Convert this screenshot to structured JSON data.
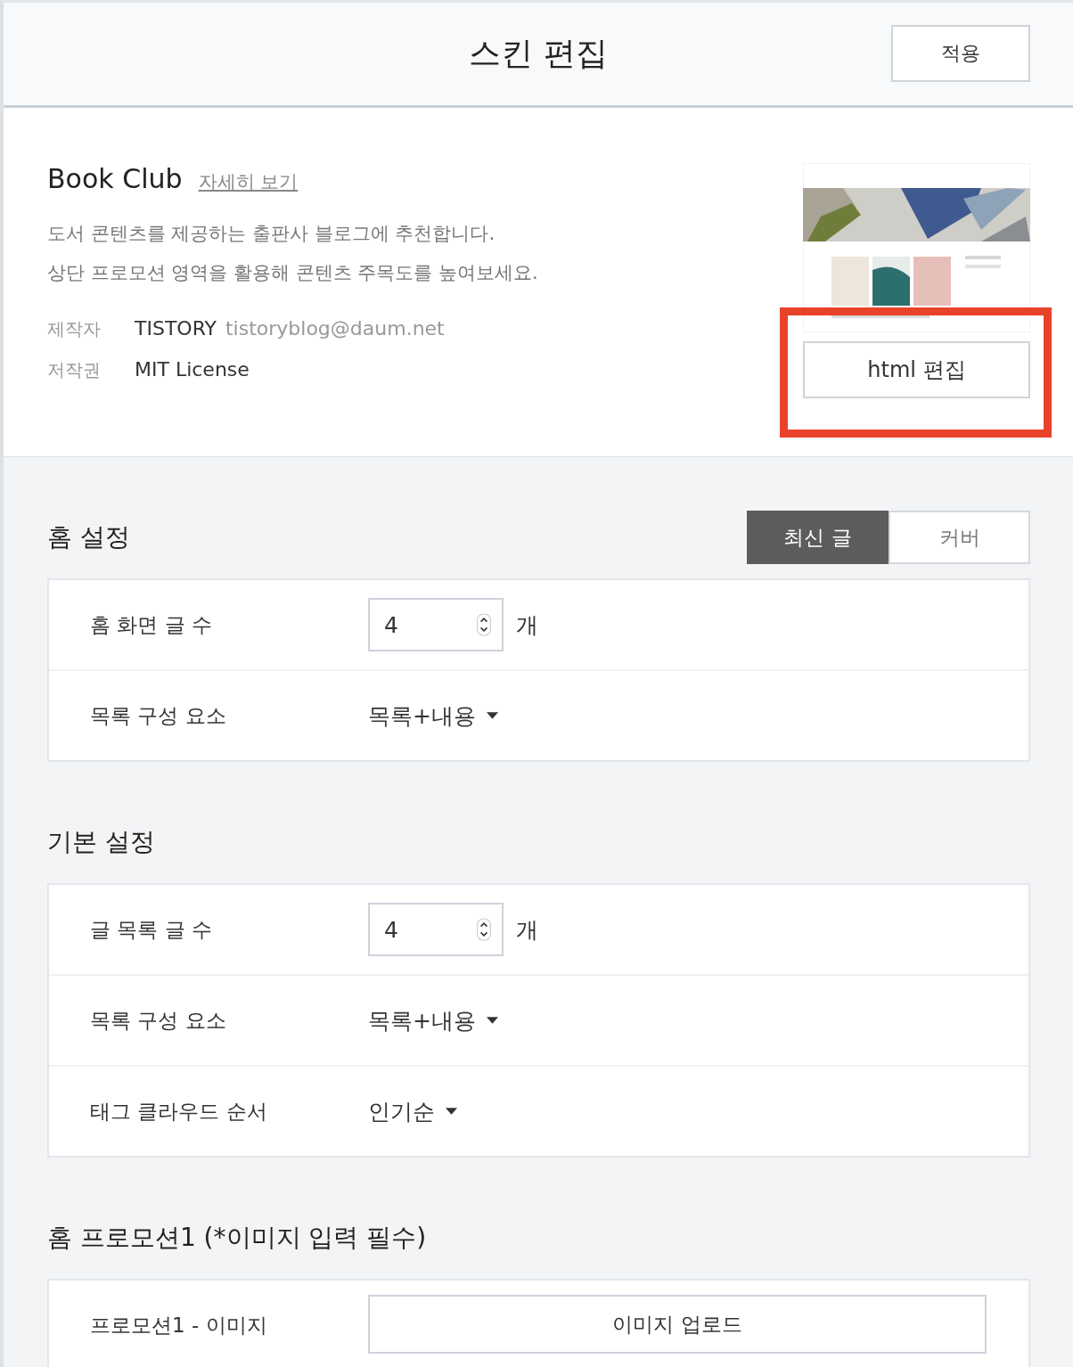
{
  "header": {
    "title": "스킨 편집",
    "apply_button": "적용"
  },
  "skin": {
    "name": "Book Club",
    "details_link": "자세히 보기",
    "description": [
      "도서 콘텐츠를 제공하는 출판사 블로그에 추천합니다.",
      "상단 프로모션 영역을 활용해 콘텐츠 주목도를 높여보세요."
    ],
    "meta": [
      {
        "label": "제작자",
        "value": "TISTORY",
        "extra": "tistoryblog@daum.net"
      },
      {
        "label": "저작권",
        "value": "MIT License"
      }
    ],
    "preview": {
      "kind": "picture"
    },
    "html_button": "html 편집",
    "highlighted": true
  },
  "sections": [
    {
      "title": "홈 설정",
      "tabs": [
        {
          "label": "최신 글",
          "selected": true
        },
        {
          "label": "커버",
          "selected": false
        }
      ],
      "rows": [
        {
          "kind": "number",
          "label": "홈 화면 글 수",
          "value": "4",
          "unit": "개"
        },
        {
          "kind": "select",
          "label": "목록 구성 요소",
          "value": "목록+내용"
        }
      ]
    },
    {
      "title": "기본 설정",
      "rows": [
        {
          "kind": "number",
          "label": "글 목록 글 수",
          "value": "4",
          "unit": "개"
        },
        {
          "kind": "select",
          "label": "목록 구성 요소",
          "value": "목록+내용"
        },
        {
          "kind": "select",
          "label": "태그 클라우드 순서",
          "value": "인기순"
        }
      ]
    },
    {
      "title": "홈 프로모션1 (*이미지 입력 필수)",
      "rows": [
        {
          "kind": "upload",
          "label": "프로모션1 - 이미지",
          "value": "이미지 업로드"
        }
      ]
    }
  ]
}
